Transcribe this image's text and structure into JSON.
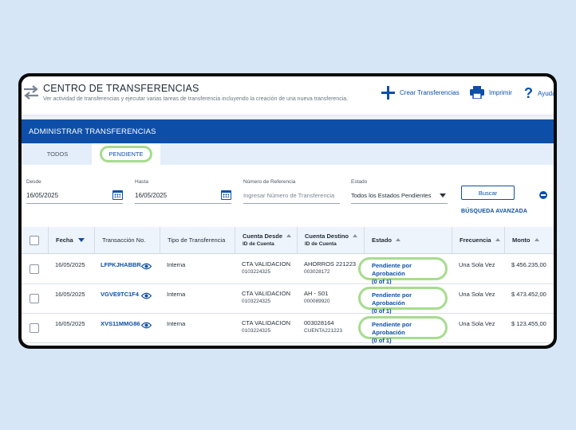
{
  "header": {
    "title": "CENTRO DE TRANSFERENCIAS",
    "subtitle": "Ver actividad de transferencias y ejecutar varias tareas de transferencia incluyendo la creación de una nueva transferencia.",
    "create_label": "Crear Transferencias",
    "print_label": "Imprimir",
    "help_label": "Ayuda"
  },
  "section_title": "ADMINISTRAR TRANSFERENCIAS",
  "tabs": [
    {
      "label": "TODOS",
      "active": false
    },
    {
      "label": "PENDIENTE",
      "active": true
    }
  ],
  "filters": {
    "desde_label": "Desde",
    "desde_value": "16/05/2025",
    "hasta_label": "Hasta",
    "hasta_value": "16/05/2025",
    "referencia_label": "Número de Referencia",
    "referencia_placeholder": "Ingresar Número de Transferencia",
    "estado_label": "Estado",
    "estado_value": "Todos los Estados Pendientes",
    "search_button": "Buscar",
    "advanced_search": "BÚSQUEDA AVANZADA"
  },
  "table": {
    "columns": {
      "fecha": "Fecha",
      "transaccion": "Transacción No.",
      "tipo": "Tipo de Transferencia",
      "desde": "Cuenta Desde",
      "desde_sub": "ID de Cuenta",
      "destino": "Cuenta Destino",
      "destino_sub": "ID de Cuenta",
      "estado": "Estado",
      "frecuencia": "Frecuencia",
      "monto": "Monto"
    },
    "rows": [
      {
        "fecha": "16/05/2025",
        "transaccion": "LFPKJHABBR",
        "tipo": "Interna",
        "desde": "CTA VALIDACION",
        "desde_id": "0103224325",
        "destino": "AHORROS 221223",
        "destino_id": "003028172",
        "estado_1": "Pendiente por Aprobación",
        "estado_2": "(0 of 1)",
        "frecuencia": "Una Sola Vez",
        "monto": "$ 456.235,00"
      },
      {
        "fecha": "16/05/2025",
        "transaccion": "VGVE9TC1F4",
        "tipo": "Interna",
        "desde": "CTA VALIDACION",
        "desde_id": "0103224325",
        "destino": "AH - S01",
        "destino_id": "000089920",
        "estado_1": "Pendiente por Aprobación",
        "estado_2": "(0 of 1)",
        "frecuencia": "Una Sola Vez",
        "monto": "$ 473.452,00"
      },
      {
        "fecha": "16/05/2025",
        "transaccion": "XVS11MMG86",
        "tipo": "Interna",
        "desde": "CTA VALIDACION",
        "desde_id": "0103224325",
        "destino": "003028164",
        "destino_id": "CUENTA221223",
        "estado_1": "Pendiente por Aprobación",
        "estado_2": "(0 of 1)",
        "frecuencia": "Una Sola Vez",
        "monto": "$ 123.455,00"
      }
    ]
  },
  "colors": {
    "brand_blue": "#0d4fa8",
    "highlight_green": "#a6dc8e",
    "background": "#d6e6f7"
  },
  "icons": [
    "transfer-arrows-icon",
    "plus-icon",
    "printer-icon",
    "help-icon",
    "calendar-icon",
    "chevron-down-icon",
    "collapse-icon",
    "eye-icon",
    "sort-icon"
  ]
}
